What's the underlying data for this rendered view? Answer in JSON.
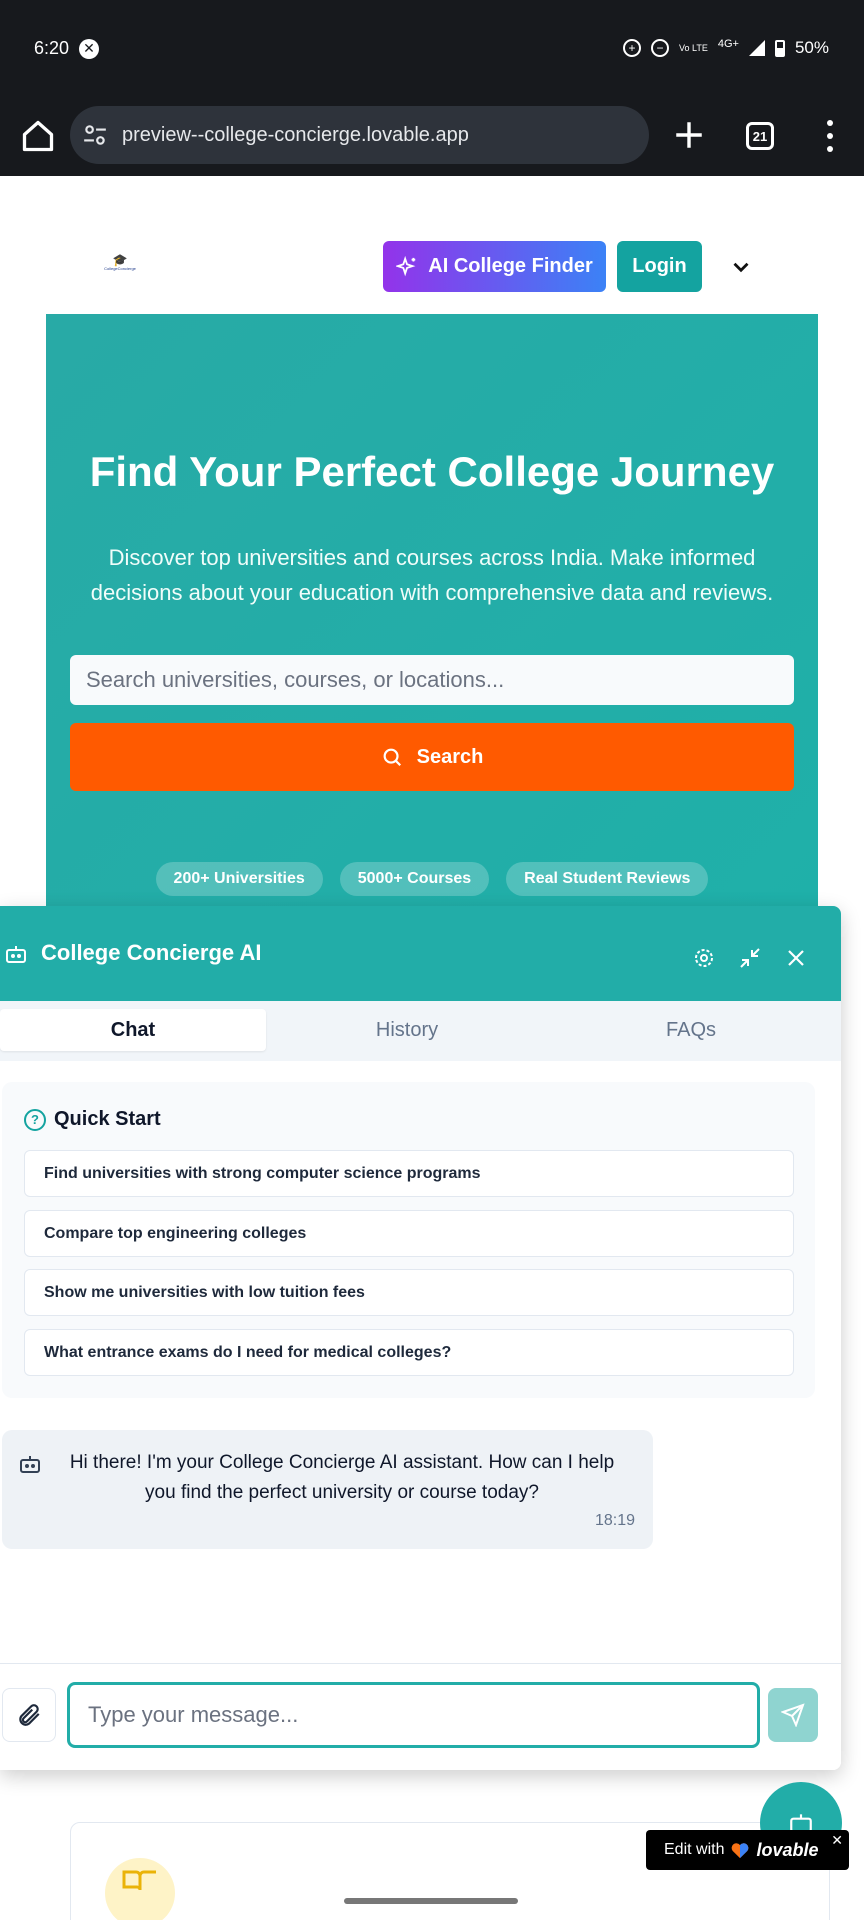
{
  "status_bar": {
    "time": "6:20",
    "network": "4G+",
    "volte": "Vo LTE",
    "battery": "50%"
  },
  "browser": {
    "url": "preview--college-concierge.lovable.app",
    "tab_count": "21"
  },
  "header": {
    "logo_text": "CollegeConcierge",
    "ai_finder_label": "AI College Finder",
    "login_label": "Login"
  },
  "hero": {
    "title": "Find Your Perfect College Journey",
    "subtitle": "Discover top universities and courses across India. Make informed decisions about your education with comprehensive data and reviews.",
    "search_placeholder": "Search universities, courses, or locations...",
    "search_button": "Search",
    "pills": [
      "200+ Universities",
      "5000+ Courses",
      "Real Student Reviews"
    ]
  },
  "chat": {
    "title": "College Concierge AI",
    "tabs": [
      "Chat",
      "History",
      "FAQs"
    ],
    "active_tab": "Chat",
    "quick_start": {
      "heading": "Quick Start",
      "items": [
        "Find universities with strong computer science programs",
        "Compare top engineering colleges",
        "Show me universities with low tuition fees",
        "What entrance exams do I need for medical colleges?"
      ]
    },
    "messages": [
      {
        "sender": "bot",
        "text": "Hi there! I'm your College Concierge AI assistant. How can I help you find the perfect university or course today?",
        "time": "18:19"
      }
    ],
    "input_placeholder": "Type your message..."
  },
  "badge": {
    "prefix": "Edit with",
    "brand": "lovable"
  },
  "colors": {
    "teal": "#22ada8",
    "orange": "#ff5a00",
    "gradient_start": "#9333ea",
    "gradient_end": "#3b82f6"
  }
}
